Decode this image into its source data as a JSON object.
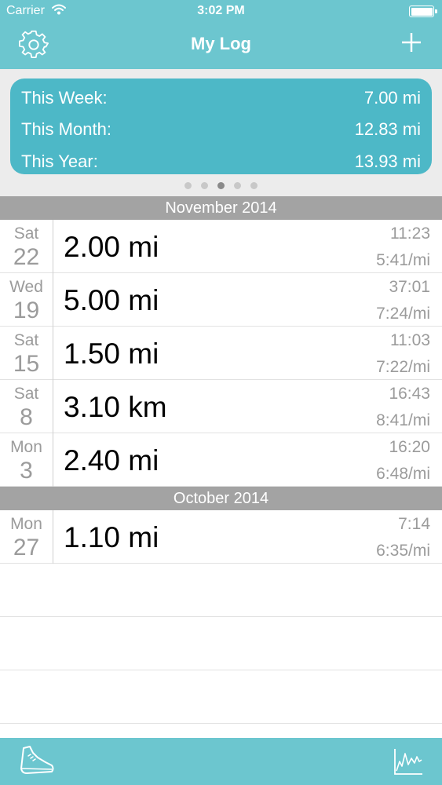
{
  "status_bar": {
    "carrier": "Carrier",
    "time": "3:02 PM",
    "wifi_icon": "wifi-icon",
    "battery_icon": "battery-icon"
  },
  "nav": {
    "title": "My Log",
    "settings_icon": "gear-icon",
    "add_icon": "plus-icon"
  },
  "summary": {
    "rows": [
      {
        "label": "This Week:",
        "value": "7.00 mi"
      },
      {
        "label": "This Month:",
        "value": "12.83 mi"
      },
      {
        "label": "This Year:",
        "value": "13.93 mi"
      }
    ],
    "page_count": 5,
    "active_page": 3
  },
  "sections": [
    {
      "title": "November 2014",
      "entries": [
        {
          "day": "Sat",
          "date": "22",
          "distance": "2.00 mi",
          "time": "11:23",
          "pace": "5:41/mi"
        },
        {
          "day": "Wed",
          "date": "19",
          "distance": "5.00 mi",
          "time": "37:01",
          "pace": "7:24/mi"
        },
        {
          "day": "Sat",
          "date": "15",
          "distance": "1.50 mi",
          "time": "11:03",
          "pace": "7:22/mi"
        },
        {
          "day": "Sat",
          "date": "8",
          "distance": "3.10 km",
          "time": "16:43",
          "pace": "8:41/mi"
        },
        {
          "day": "Mon",
          "date": "3",
          "distance": "2.40 mi",
          "time": "16:20",
          "pace": "6:48/mi"
        }
      ]
    },
    {
      "title": "October 2014",
      "entries": [
        {
          "day": "Mon",
          "date": "27",
          "distance": "1.10 mi",
          "time": "7:14",
          "pace": "6:35/mi"
        }
      ]
    }
  ],
  "tab_bar": {
    "left_icon": "running-shoe-icon",
    "right_icon": "line-chart-icon"
  },
  "colors": {
    "accent": "#6cc6cf",
    "card": "#4db8c7",
    "section_header": "#a3a3a3",
    "secondary_text": "#9b9b9b"
  }
}
